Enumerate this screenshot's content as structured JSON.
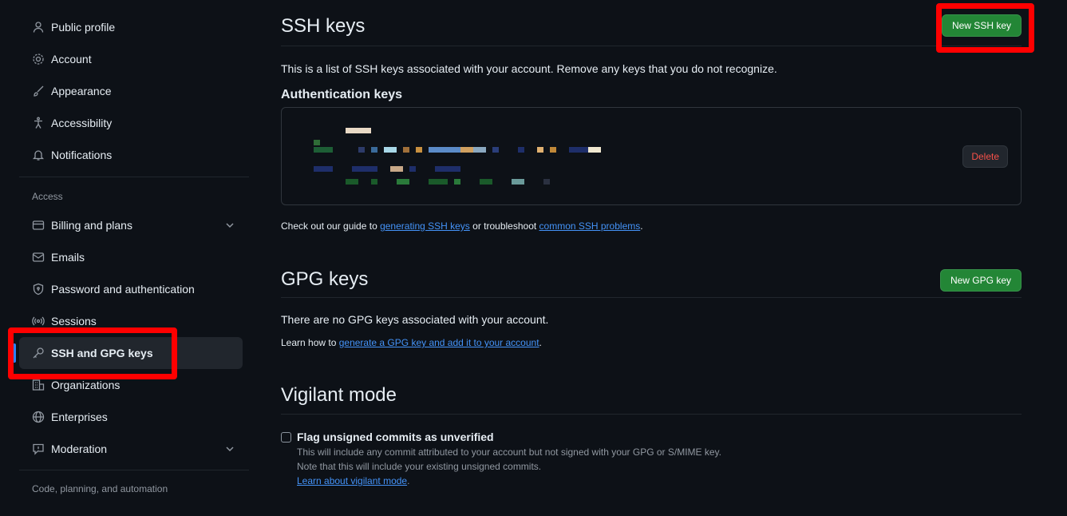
{
  "sidebar": {
    "items_top": [
      {
        "label": "Public profile",
        "icon": "person-icon"
      },
      {
        "label": "Account",
        "icon": "gear-icon"
      },
      {
        "label": "Appearance",
        "icon": "paintbrush-icon"
      },
      {
        "label": "Accessibility",
        "icon": "accessibility-icon"
      },
      {
        "label": "Notifications",
        "icon": "bell-icon"
      }
    ],
    "access_heading": "Access",
    "items_access": [
      {
        "label": "Billing and plans",
        "icon": "credit-card-icon"
      },
      {
        "label": "Emails",
        "icon": "mail-icon"
      },
      {
        "label": "Password and authentication",
        "icon": "shield-lock-icon"
      },
      {
        "label": "Sessions",
        "icon": "broadcast-icon"
      },
      {
        "label": "SSH and GPG keys",
        "icon": "key-icon"
      },
      {
        "label": "Organizations",
        "icon": "organization-icon"
      },
      {
        "label": "Enterprises",
        "icon": "globe-icon"
      },
      {
        "label": "Moderation",
        "icon": "report-icon"
      }
    ],
    "code_heading": "Code, planning, and automation"
  },
  "ssh": {
    "title": "SSH keys",
    "new_button": "New SSH key",
    "description": "This is a list of SSH keys associated with your account. Remove any keys that you do not recognize.",
    "auth_heading": "Authentication keys",
    "delete_button": "Delete",
    "guide_prefix": "Check out our guide to ",
    "guide_link1": "generating SSH keys",
    "guide_middle": " or troubleshoot ",
    "guide_link2": "common SSH problems",
    "guide_suffix": "."
  },
  "gpg": {
    "title": "GPG keys",
    "new_button": "New GPG key",
    "empty_text": "There are no GPG keys associated with your account.",
    "learn_prefix": "Learn how to ",
    "learn_link": "generate a GPG key and add it to your account",
    "learn_suffix": "."
  },
  "vigilant": {
    "title": "Vigilant mode",
    "checkbox_label": "Flag unsigned commits as unverified",
    "checked": false,
    "note1": "This will include any commit attributed to your account but not signed with your GPG or S/MIME key.",
    "note2": "Note that this will include your existing unsigned commits.",
    "learn_link": "Learn about vigilant mode",
    "learn_suffix": "."
  },
  "colors": {
    "background": "#0d1117",
    "accent_green": "#238636",
    "link_blue": "#4493f8",
    "danger": "#f85149",
    "highlight_red": "#ff0000",
    "selected_bar": "#2f81f7"
  }
}
